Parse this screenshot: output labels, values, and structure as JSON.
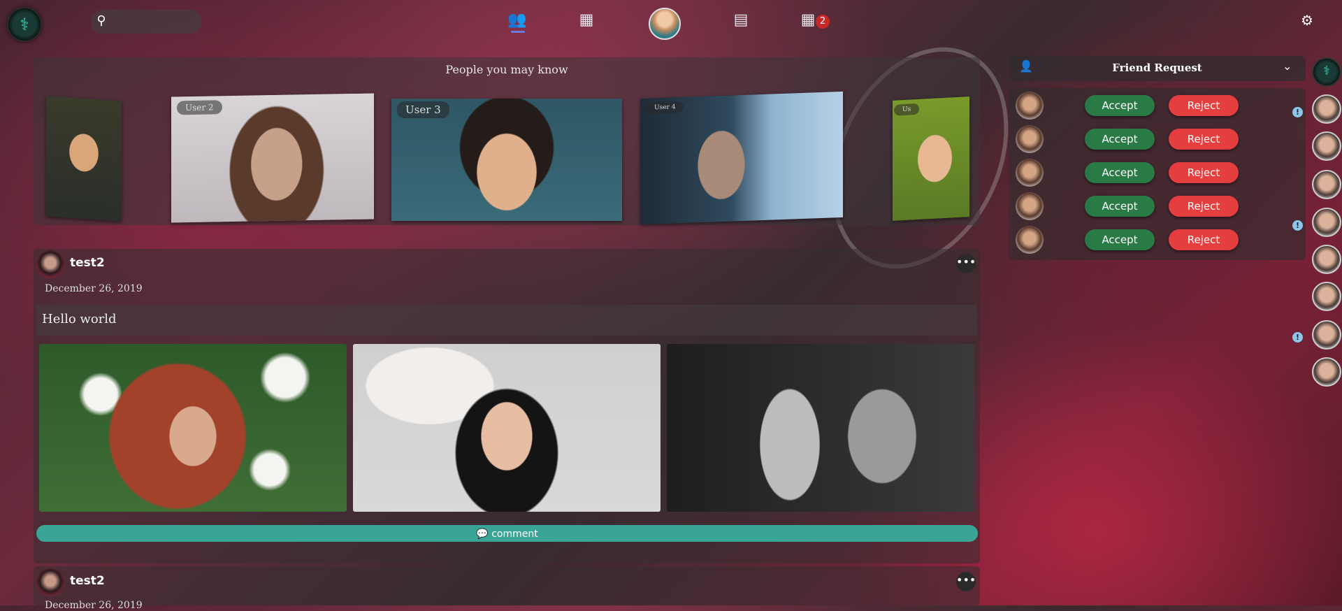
{
  "app": {
    "title": ""
  },
  "topbar": {
    "search": {
      "placeholder": "",
      "value": ""
    },
    "nav": [
      {
        "name": "friends-icon"
      },
      {
        "name": "calendar-icon"
      },
      {
        "name": "profile-avatar"
      },
      {
        "name": "newspaper-icon"
      },
      {
        "name": "apps-grid-icon"
      }
    ],
    "apps_badge": "2"
  },
  "people_you_may_know": {
    "title": "People you may know",
    "cards": [
      {
        "label": ""
      },
      {
        "label": "User 2"
      },
      {
        "label": "User 3"
      },
      {
        "label": "User 4"
      },
      {
        "label": "Us"
      }
    ]
  },
  "posts": [
    {
      "user": "test2",
      "date": "December 26, 2019",
      "text": "Hello world",
      "comment_label": "comment"
    },
    {
      "user": "test2",
      "date": "December 26, 2019"
    }
  ],
  "friend_requests": {
    "title": "Friend Request",
    "accept_label": "Accept",
    "reject_label": "Reject",
    "count": 5
  },
  "colors": {
    "accept": "#2a7a46",
    "reject": "#e53e3e",
    "comment": "#3aa597",
    "badge": "#c62828",
    "nav_active": "#6c7ae0"
  }
}
